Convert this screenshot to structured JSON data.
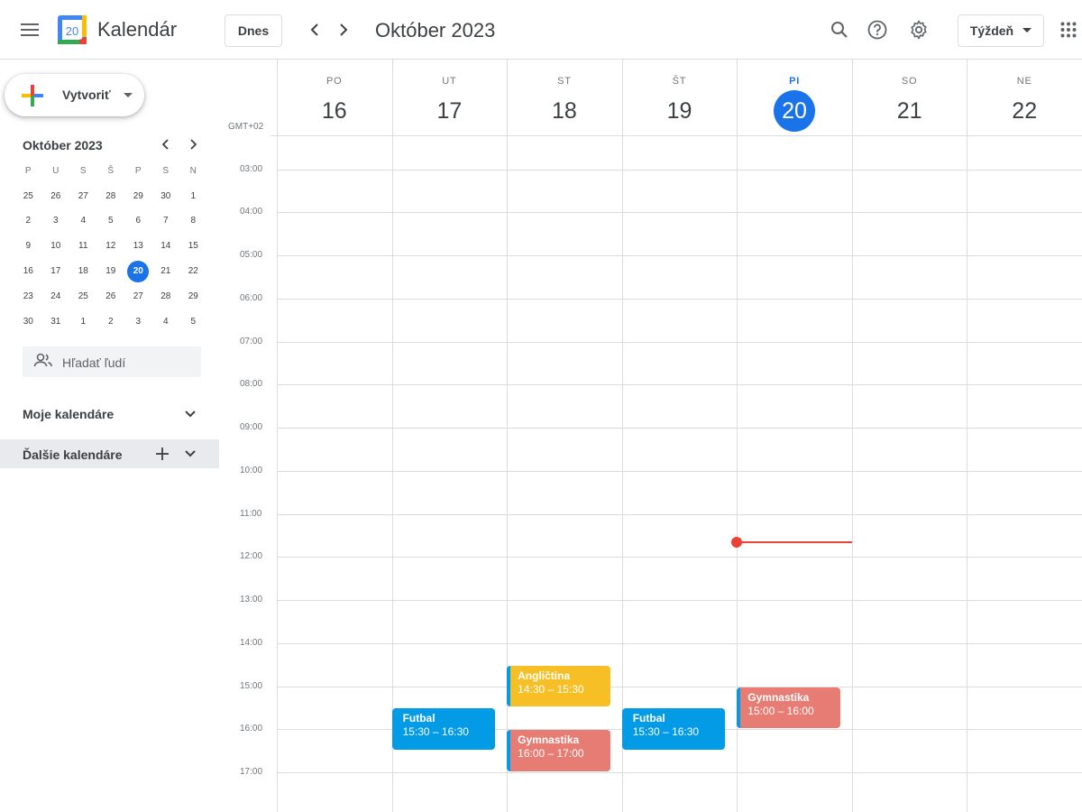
{
  "header": {
    "app_title": "Kalendár",
    "logo_day": "20",
    "today_label": "Dnes",
    "period_title": "Október 2023",
    "view_label": "Týždeň"
  },
  "sidebar": {
    "create_label": "Vytvoriť",
    "mini_calendar": {
      "title": "Október 2023",
      "weekdays": [
        "P",
        "U",
        "S",
        "Š",
        "P",
        "S",
        "N"
      ],
      "weeks": [
        [
          "25",
          "26",
          "27",
          "28",
          "29",
          "30",
          "1"
        ],
        [
          "2",
          "3",
          "4",
          "5",
          "6",
          "7",
          "8"
        ],
        [
          "9",
          "10",
          "11",
          "12",
          "13",
          "14",
          "15"
        ],
        [
          "16",
          "17",
          "18",
          "19",
          "20",
          "21",
          "22"
        ],
        [
          "23",
          "24",
          "25",
          "26",
          "27",
          "28",
          "29"
        ],
        [
          "30",
          "31",
          "1",
          "2",
          "3",
          "4",
          "5"
        ]
      ],
      "today": "20"
    },
    "people_search_placeholder": "Hľadať ľudí",
    "my_calendars_label": "Moje kalendáre",
    "other_calendars_label": "Ďalšie kalendáre"
  },
  "week": {
    "timezone": "GMT+02",
    "days": [
      {
        "dow": "PO",
        "num": "16",
        "today": false
      },
      {
        "dow": "UT",
        "num": "17",
        "today": false
      },
      {
        "dow": "ST",
        "num": "18",
        "today": false
      },
      {
        "dow": "ŠT",
        "num": "19",
        "today": false
      },
      {
        "dow": "PI",
        "num": "20",
        "today": true
      },
      {
        "dow": "SO",
        "num": "21",
        "today": false
      },
      {
        "dow": "NE",
        "num": "22",
        "today": false
      }
    ],
    "hours": [
      "03:00",
      "04:00",
      "05:00",
      "06:00",
      "07:00",
      "08:00",
      "09:00",
      "10:00",
      "11:00",
      "12:00",
      "13:00",
      "14:00",
      "15:00",
      "16:00",
      "17:00"
    ],
    "current_time": "11:40",
    "events": [
      {
        "day": 1,
        "title": "Futbal",
        "time": "15:30 – 16:30",
        "start": 15.5,
        "end": 16.5,
        "color": "blue"
      },
      {
        "day": 2,
        "title": "Angličtina",
        "time": "14:30 – 15:30",
        "start": 14.5,
        "end": 15.5,
        "color": "yellow"
      },
      {
        "day": 2,
        "title": "Gymnastika",
        "time": "16:00 – 17:00",
        "start": 16.0,
        "end": 17.0,
        "color": "red"
      },
      {
        "day": 3,
        "title": "Futbal",
        "time": "15:30 – 16:30",
        "start": 15.5,
        "end": 16.5,
        "color": "blue"
      },
      {
        "day": 4,
        "title": "Gymnastika",
        "time": "15:00 – 16:00",
        "start": 15.0,
        "end": 16.0,
        "color": "red"
      }
    ]
  },
  "colors": {
    "accent": "#1a73e8",
    "event_blue": "#039be5",
    "event_yellow": "#f6bf26",
    "event_red": "#e67c73",
    "now_indicator": "#ea4335"
  }
}
